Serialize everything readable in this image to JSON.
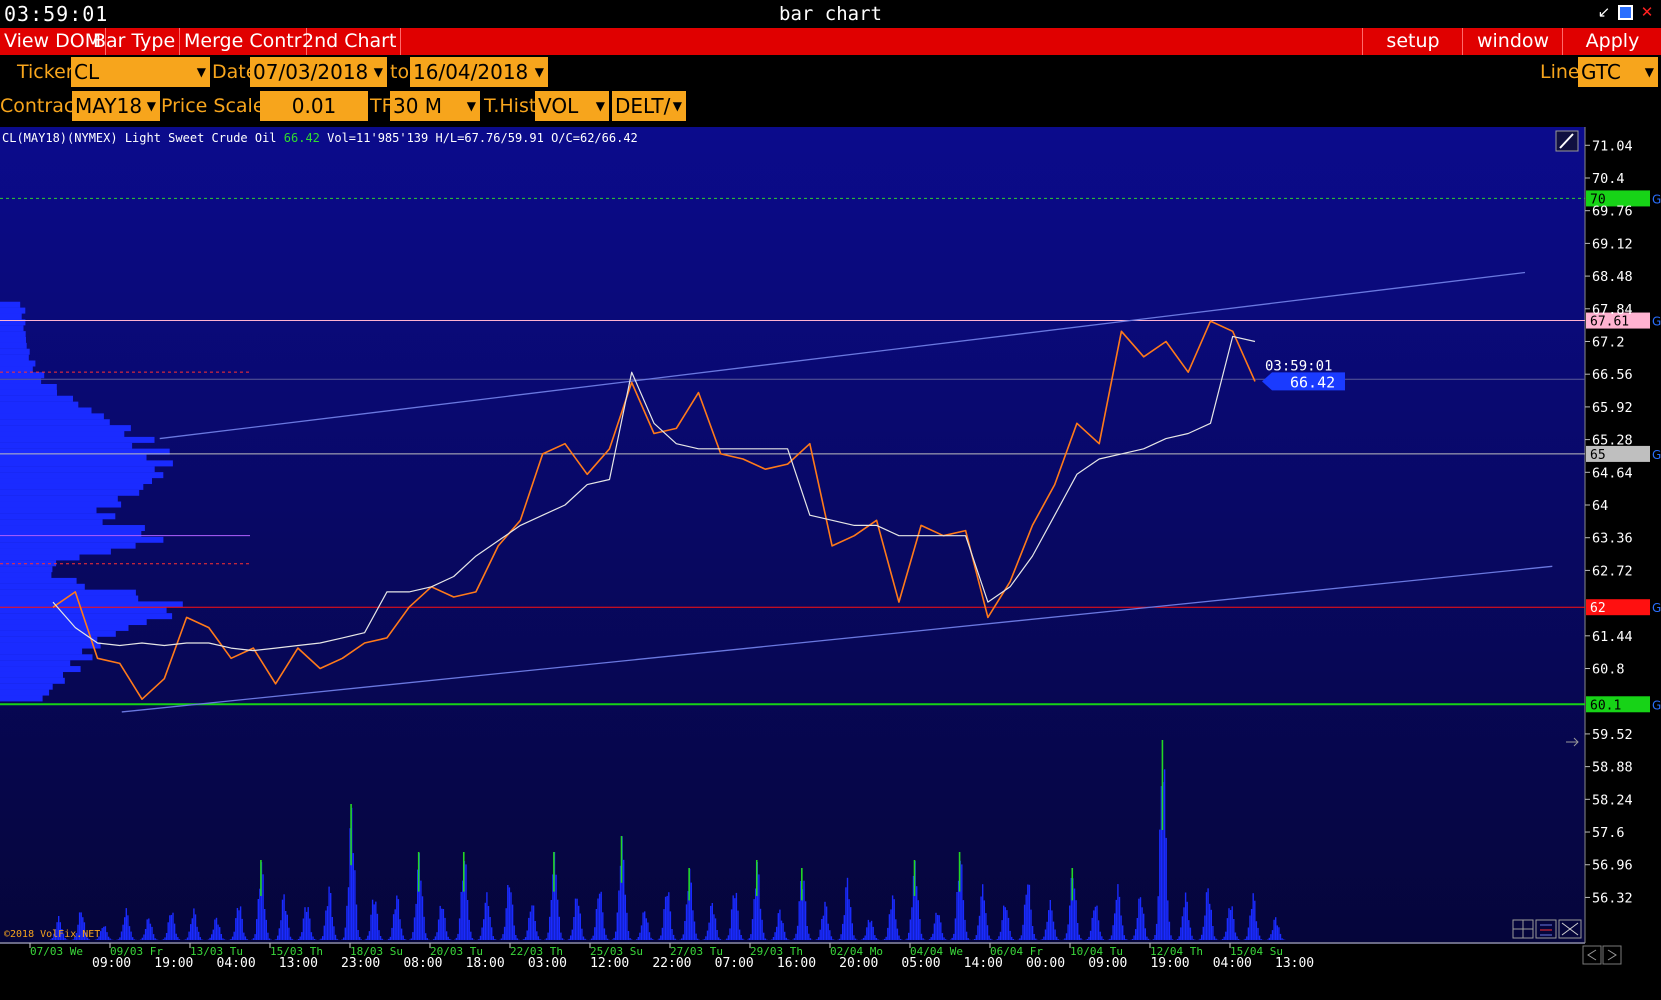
{
  "titlebar": {
    "clock": "03:59:01",
    "title": "bar chart"
  },
  "menu": {
    "left": [
      "View DOM",
      "Bar Type",
      "Merge Contr",
      "2nd Chart"
    ],
    "setup": "setup",
    "window": "window",
    "apply": "Apply"
  },
  "controls": {
    "ticker_label": "Ticker",
    "ticker": "CL",
    "date_label": "Date",
    "date_from": "07/03/2018",
    "to_label": "to",
    "date_to": "16/04/2018",
    "line_label": "Line",
    "line": "GTC",
    "contract_label": "Contract",
    "contract": "MAY18",
    "price_scale_label": "Price Scale",
    "price_scale": "0.01",
    "tf_label": "TF",
    "tf": "30 M",
    "thist_label": "T.Hist",
    "thist": "VOL",
    "delta": "DELT/"
  },
  "info": {
    "prefix": "CL(MAY18)(NYMEX) Light Sweet Crude Oil ",
    "last": "66.42",
    "rest": " Vol=11'985'139 H/L=67.76/59.91 O/C=62/66.42"
  },
  "copyright": "©2018 VolFix.NET",
  "colors": {
    "chart_bg_top": "#0b0b8c",
    "chart_bg_bottom": "#05053a",
    "price_line": "#ff7a1a",
    "vwap": "#e6e6e6",
    "trend": "#6a78e0",
    "volume": "#1a2bff",
    "volume_spike": "#24d624",
    "green_level": "#17d317",
    "red_level": "#ff1010",
    "pink_level": "#ffb3d1",
    "grey_level": "#bfbfbf",
    "accent": "#f7a51c",
    "menu": "#e00000"
  },
  "chart_data": {
    "type": "line",
    "ylim": [
      55.8,
      71.3
    ],
    "y_ticks": [
      71.04,
      70.4,
      69.76,
      69.12,
      68.48,
      67.84,
      67.2,
      66.56,
      65.92,
      65.28,
      64.64,
      64,
      63.36,
      62.72,
      61.44,
      60.8,
      59.52,
      58.88,
      58.24,
      57.6,
      56.96,
      56.32
    ],
    "date_labels": [
      "07/03 We",
      "09/03 Fr",
      "13/03 Tu",
      "15/03 Th",
      "18/03 Su",
      "20/03 Tu",
      "22/03 Th",
      "25/03 Su",
      "27/03 Tu",
      "29/03 Th",
      "02/04 Mo",
      "04/04 We",
      "06/04 Fr",
      "10/04 Tu",
      "12/04 Th",
      "15/04 Su"
    ],
    "time_labels": [
      "09:00",
      "19:00",
      "04:00",
      "13:00",
      "23:00",
      "08:00",
      "18:00",
      "03:00",
      "12:00",
      "22:00",
      "07:00",
      "16:00",
      "20:00",
      "05:00",
      "14:00",
      "00:00",
      "09:00",
      "19:00",
      "04:00",
      "13:00"
    ],
    "series": [
      {
        "values": [
          62.0,
          62.3,
          61.0,
          60.9,
          60.2,
          60.6,
          61.8,
          61.6,
          61.0,
          61.2,
          60.5,
          61.2,
          60.8,
          61.0,
          61.3,
          61.4,
          62.0,
          62.4,
          62.2,
          62.3,
          63.2,
          63.7,
          65.0,
          65.2,
          64.6,
          65.1,
          66.4,
          65.4,
          65.5,
          66.2,
          65.0,
          64.9,
          64.7,
          64.8,
          65.2,
          63.2,
          63.4,
          63.7,
          62.1,
          63.6,
          63.4,
          63.5,
          61.8,
          62.5,
          63.6,
          64.4,
          65.6,
          65.2,
          67.4,
          66.9,
          67.2,
          66.6,
          67.6,
          67.4,
          66.42
        ]
      },
      {
        "values": [
          62.1,
          61.6,
          61.3,
          61.25,
          61.3,
          61.25,
          61.3,
          61.3,
          61.2,
          61.15,
          61.2,
          61.25,
          61.3,
          61.4,
          61.5,
          62.3,
          62.3,
          62.4,
          62.6,
          63.0,
          63.3,
          63.6,
          63.8,
          64.0,
          64.4,
          64.5,
          66.6,
          65.6,
          65.2,
          65.1,
          65.1,
          65.1,
          65.1,
          65.1,
          63.8,
          63.7,
          63.6,
          63.6,
          63.4,
          63.4,
          63.4,
          63.4,
          62.1,
          62.4,
          63.0,
          63.8,
          64.6,
          64.9,
          65.0,
          65.1,
          65.3,
          65.4,
          65.6,
          67.3,
          67.2
        ]
      }
    ],
    "volume": [
      3,
      4,
      2,
      4,
      3,
      4,
      4,
      3,
      5,
      10,
      6,
      5,
      7,
      17,
      6,
      6,
      11,
      5,
      11,
      6,
      8,
      5,
      11,
      6,
      7,
      13,
      4,
      7,
      9,
      5,
      7,
      10,
      4,
      9,
      5,
      8,
      3,
      6,
      10,
      4,
      11,
      7,
      5,
      8,
      5,
      9,
      5,
      7,
      6,
      25,
      6,
      7,
      5,
      6,
      3
    ],
    "levels": [
      {
        "label": "70",
        "value": 70
      },
      {
        "label": "67.61",
        "value": 67.61
      },
      {
        "label": "65",
        "value": 65
      },
      {
        "label": "62",
        "value": 62
      },
      {
        "label": "60.1",
        "value": 60.1
      }
    ],
    "last_price": "66.42",
    "last_time": "03:59:01",
    "high": 67.76,
    "low": 59.91
  }
}
